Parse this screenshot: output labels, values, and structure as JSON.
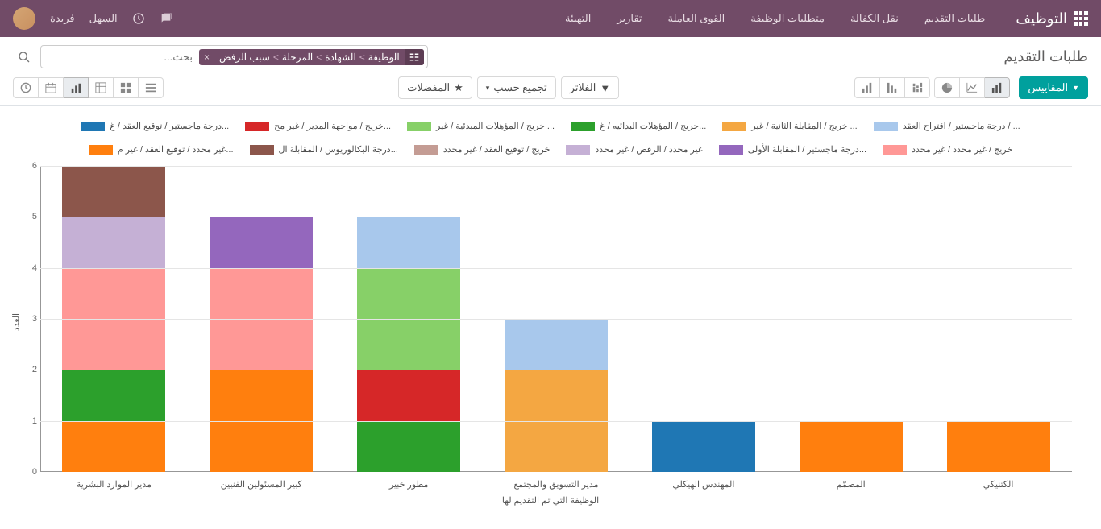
{
  "navbar": {
    "brand": "التوظيف",
    "menu": [
      {
        "label": "طلبات التقديم"
      },
      {
        "label": "نقل الكفالة"
      },
      {
        "label": "متطلبات الوظيفة"
      },
      {
        "label": "القوى العاملة"
      },
      {
        "label": "تقارير"
      },
      {
        "label": "التهيئة"
      }
    ],
    "company": "السهل",
    "user": "فريدة"
  },
  "breadcrumb": {
    "title": "طلبات التقديم"
  },
  "search": {
    "facet_parts": [
      "الوظيفة",
      "الشهادة",
      "المرحلة",
      "سبب الرفض"
    ],
    "placeholder": "بحث..."
  },
  "toolbar": {
    "measures": "المقاييس",
    "filters": "الفلاتر",
    "group_by": "تجميع حسب",
    "favorites": "المفضلات"
  },
  "chart_data": {
    "type": "bar",
    "stacked": true,
    "xlabel": "الوظيفة التي تم التقديم لها",
    "ylabel": "العدد",
    "ylim": [
      0,
      6
    ],
    "categories": [
      "مدير الموارد البشرية",
      "كبير المسئولين الفنيين",
      "مطور خبير",
      "مدير التسويق والمجتمع",
      "المهندس الهيكلي",
      "المصمّم",
      "الكتنيكي"
    ],
    "series": [
      {
        "name": "درجة ماجستير / توقيع العقد / غ...",
        "color": "#1f77b4",
        "values": [
          0,
          0,
          0,
          0,
          1,
          0,
          0
        ]
      },
      {
        "name": "خريج / مواجهة المدير / غير مح...",
        "color": "#d62728",
        "values": [
          0,
          0,
          1,
          0,
          0,
          0,
          0
        ]
      },
      {
        "name": "خريج / المؤهلات المبدئية / غير ...",
        "color": "#87d068",
        "values": [
          0,
          0,
          2,
          0,
          0,
          0,
          0
        ]
      },
      {
        "name": "خريج / المؤهلات البدائيه / غ...",
        "color": "#2ca02c",
        "values": [
          1,
          0,
          1,
          0,
          0,
          0,
          0
        ]
      },
      {
        "name": "خريج / المقابلة الثانية / غير ...",
        "color": "#f4a742",
        "values": [
          0,
          0,
          0,
          2,
          0,
          0,
          0
        ]
      },
      {
        "name": "درجة ماجستير / اقتراح العقد / ...",
        "color": "#a8c8ec",
        "values": [
          0,
          0,
          1,
          1,
          0,
          0,
          0
        ]
      },
      {
        "name": "غير محدد / توقيع العقد / غير م...",
        "color": "#ff7f0e",
        "values": [
          1,
          2,
          0,
          0,
          0,
          1,
          1
        ]
      },
      {
        "name": "درجة البكالوريوس / المقابلة ال...",
        "color": "#8c564b",
        "values": [
          1,
          0,
          0,
          0,
          0,
          0,
          0
        ]
      },
      {
        "name": "خريج / توقيع العقد / غير محدد",
        "color": "#c49c94",
        "values": [
          0,
          0,
          0,
          0,
          0,
          0,
          0
        ]
      },
      {
        "name": "غير محدد / الرفض / غير محدد",
        "color": "#c5b0d5",
        "values": [
          1,
          0,
          0,
          0,
          0,
          0,
          0
        ]
      },
      {
        "name": "درجة ماجستير / المقابلة الأولى...",
        "color": "#9467bd",
        "values": [
          0,
          1,
          0,
          0,
          0,
          0,
          0
        ]
      },
      {
        "name": "خريج / غير محدد / غير محدد",
        "color": "#ff9896",
        "values": [
          2,
          2,
          0,
          0,
          0,
          0,
          0
        ]
      }
    ],
    "draw_order": [
      6,
      3,
      11,
      9,
      10,
      7,
      0,
      1,
      2,
      4,
      5
    ]
  },
  "colors": {
    "primary": "#714b67",
    "teal": "#00a09d"
  }
}
